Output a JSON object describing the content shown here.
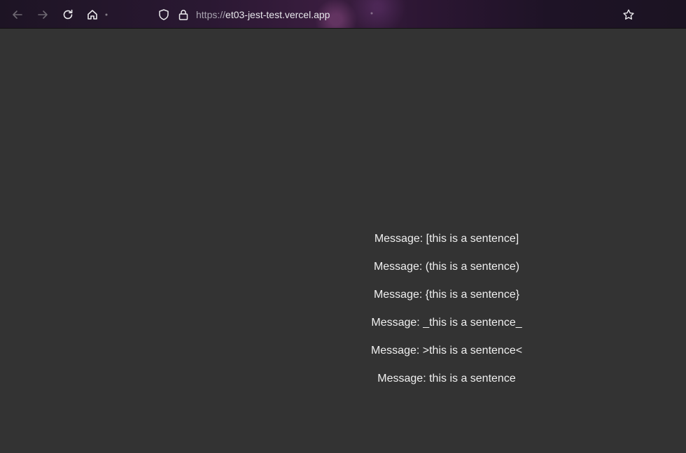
{
  "browser": {
    "url_scheme": "https://",
    "url_host": "et03-jest-test.vercel.app",
    "icons": {
      "back": "arrow-left-icon",
      "forward": "arrow-right-icon",
      "reload": "reload-icon",
      "home": "home-icon",
      "shield": "shield-icon",
      "lock": "lock-icon",
      "bookmark": "star-icon"
    }
  },
  "messages": [
    "Message: [this is a sentence]",
    "Message: (this is a sentence)",
    "Message: {this is a sentence}",
    "Message: _this is a sentence_",
    "Message: >this is a sentence<",
    "Message: this is a sentence"
  ]
}
